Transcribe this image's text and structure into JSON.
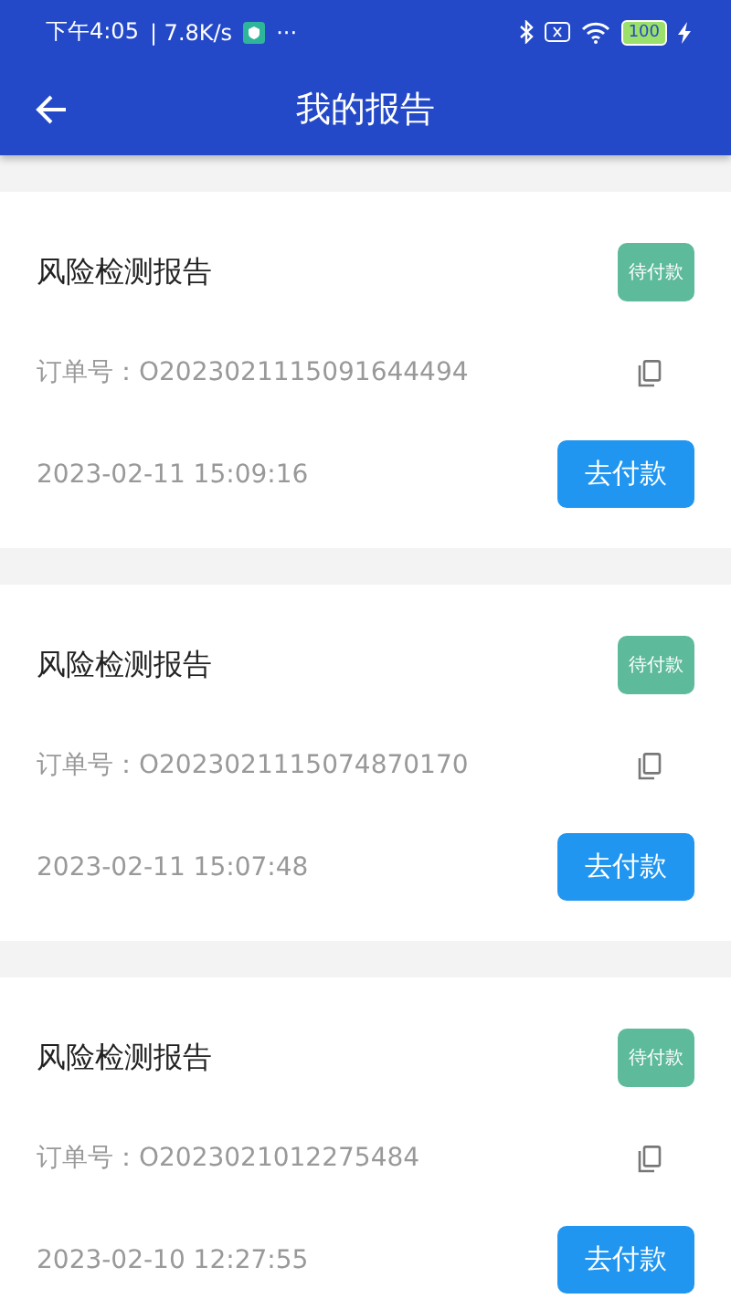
{
  "status_bar": {
    "time": "下午4:05",
    "speed": "| 7.8K/s",
    "more": "···",
    "battery": "100"
  },
  "header": {
    "title": "我的报告"
  },
  "reports": [
    {
      "title": "风险检测报告",
      "status": "待付款",
      "order_label": "订单号：",
      "order_no": "O2023021115091644494",
      "date": "2023-02-11 15:09:16",
      "action": "去付款"
    },
    {
      "title": "风险检测报告",
      "status": "待付款",
      "order_label": "订单号：",
      "order_no": "O2023021115074870170",
      "date": "2023-02-11 15:07:48",
      "action": "去付款"
    },
    {
      "title": "风险检测报告",
      "status": "待付款",
      "order_label": "订单号：",
      "order_no": "O2023021012275484",
      "date": "2023-02-10 12:27:55",
      "action": "去付款"
    }
  ]
}
